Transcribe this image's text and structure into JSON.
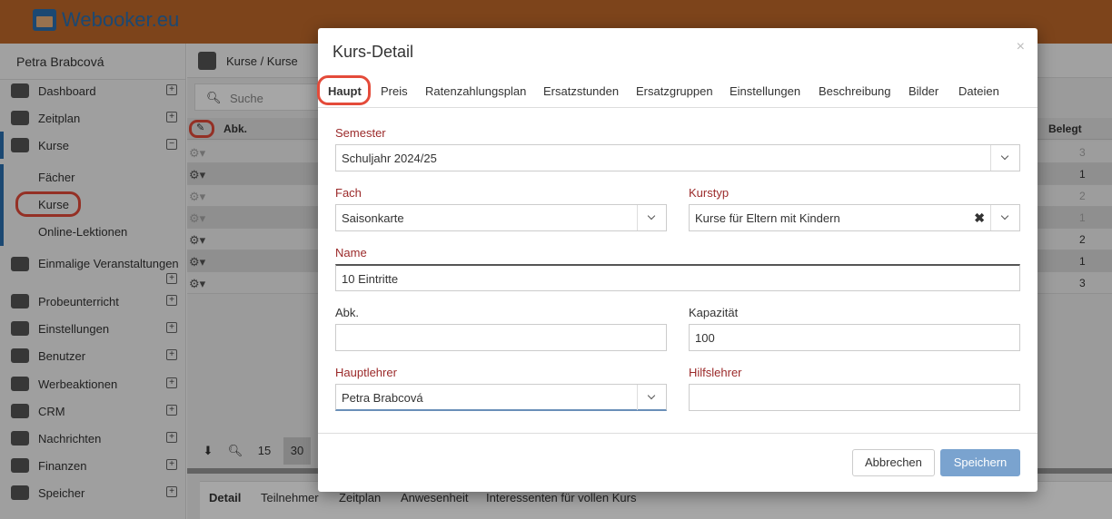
{
  "app": {
    "logo_text": "Webooker.eu"
  },
  "sidebar": {
    "user": "Petra Brabcová",
    "items": [
      {
        "label": "Dashboard",
        "icon": "home-icon"
      },
      {
        "label": "Zeitplan",
        "icon": "calendar-icon"
      },
      {
        "label": "Kurse",
        "icon": "book-icon"
      },
      {
        "label": "Einmalige Veranstaltungen",
        "icon": "ball-icon"
      },
      {
        "label": "Probeunterricht",
        "icon": "eye-slash-icon"
      },
      {
        "label": "Einstellungen",
        "icon": "server-icon"
      },
      {
        "label": "Benutzer",
        "icon": "users-icon"
      },
      {
        "label": "Werbeaktionen",
        "icon": "gift-icon"
      },
      {
        "label": "CRM",
        "icon": "handshake-icon"
      },
      {
        "label": "Nachrichten",
        "icon": "envelope-icon"
      },
      {
        "label": "Finanzen",
        "icon": "money-icon"
      },
      {
        "label": "Speicher",
        "icon": "database-icon"
      }
    ],
    "subitems": [
      "Fächer",
      "Kurse",
      "Online-Lektionen"
    ]
  },
  "main": {
    "breadcrumb": "Kurse / Kurse",
    "search_placeholder": "Suche",
    "col_abk": "Abk.",
    "col_belegt": "Belegt",
    "belegt_values": [
      "3",
      "1",
      "2",
      "1",
      "2",
      "1",
      "3"
    ],
    "pager": [
      "15",
      "30"
    ],
    "bottom_tabs": [
      "Detail",
      "Teilnehmer",
      "Zeitplan",
      "Anwesenheit",
      "Interessenten für vollen Kurs"
    ]
  },
  "modal": {
    "title": "Kurs-Detail",
    "close": "×",
    "tabs": [
      "Haupt",
      "Preis",
      "Ratenzahlungsplan",
      "Ersatzstunden",
      "Ersatzgruppen",
      "Einstellungen",
      "Beschreibung",
      "Bilder",
      "Dateien"
    ],
    "fields": {
      "semester_label": "Semester",
      "semester_value": "Schuljahr 2024/25",
      "fach_label": "Fach",
      "fach_value": "Saisonkarte",
      "kurstyp_label": "Kurstyp",
      "kurstyp_value": "Kurse für Eltern mit Kindern",
      "name_label": "Name",
      "name_value": "10 Eintritte",
      "abk_label": "Abk.",
      "abk_value": "",
      "kapazitaet_label": "Kapazität",
      "kapazitaet_value": "100",
      "hauptlehrer_label": "Hauptlehrer",
      "hauptlehrer_value": "Petra Brabcová",
      "hilfslehrer_label": "Hilfslehrer",
      "hilfslehrer_value": ""
    },
    "cancel_label": "Abbrechen",
    "save_label": "Speichern"
  },
  "colors": {
    "accent": "#c0692a",
    "brand": "#2a6fb0",
    "required_label": "#9b2a2a",
    "highlight": "#e44b3a",
    "save_button": "#7aa3cf"
  }
}
